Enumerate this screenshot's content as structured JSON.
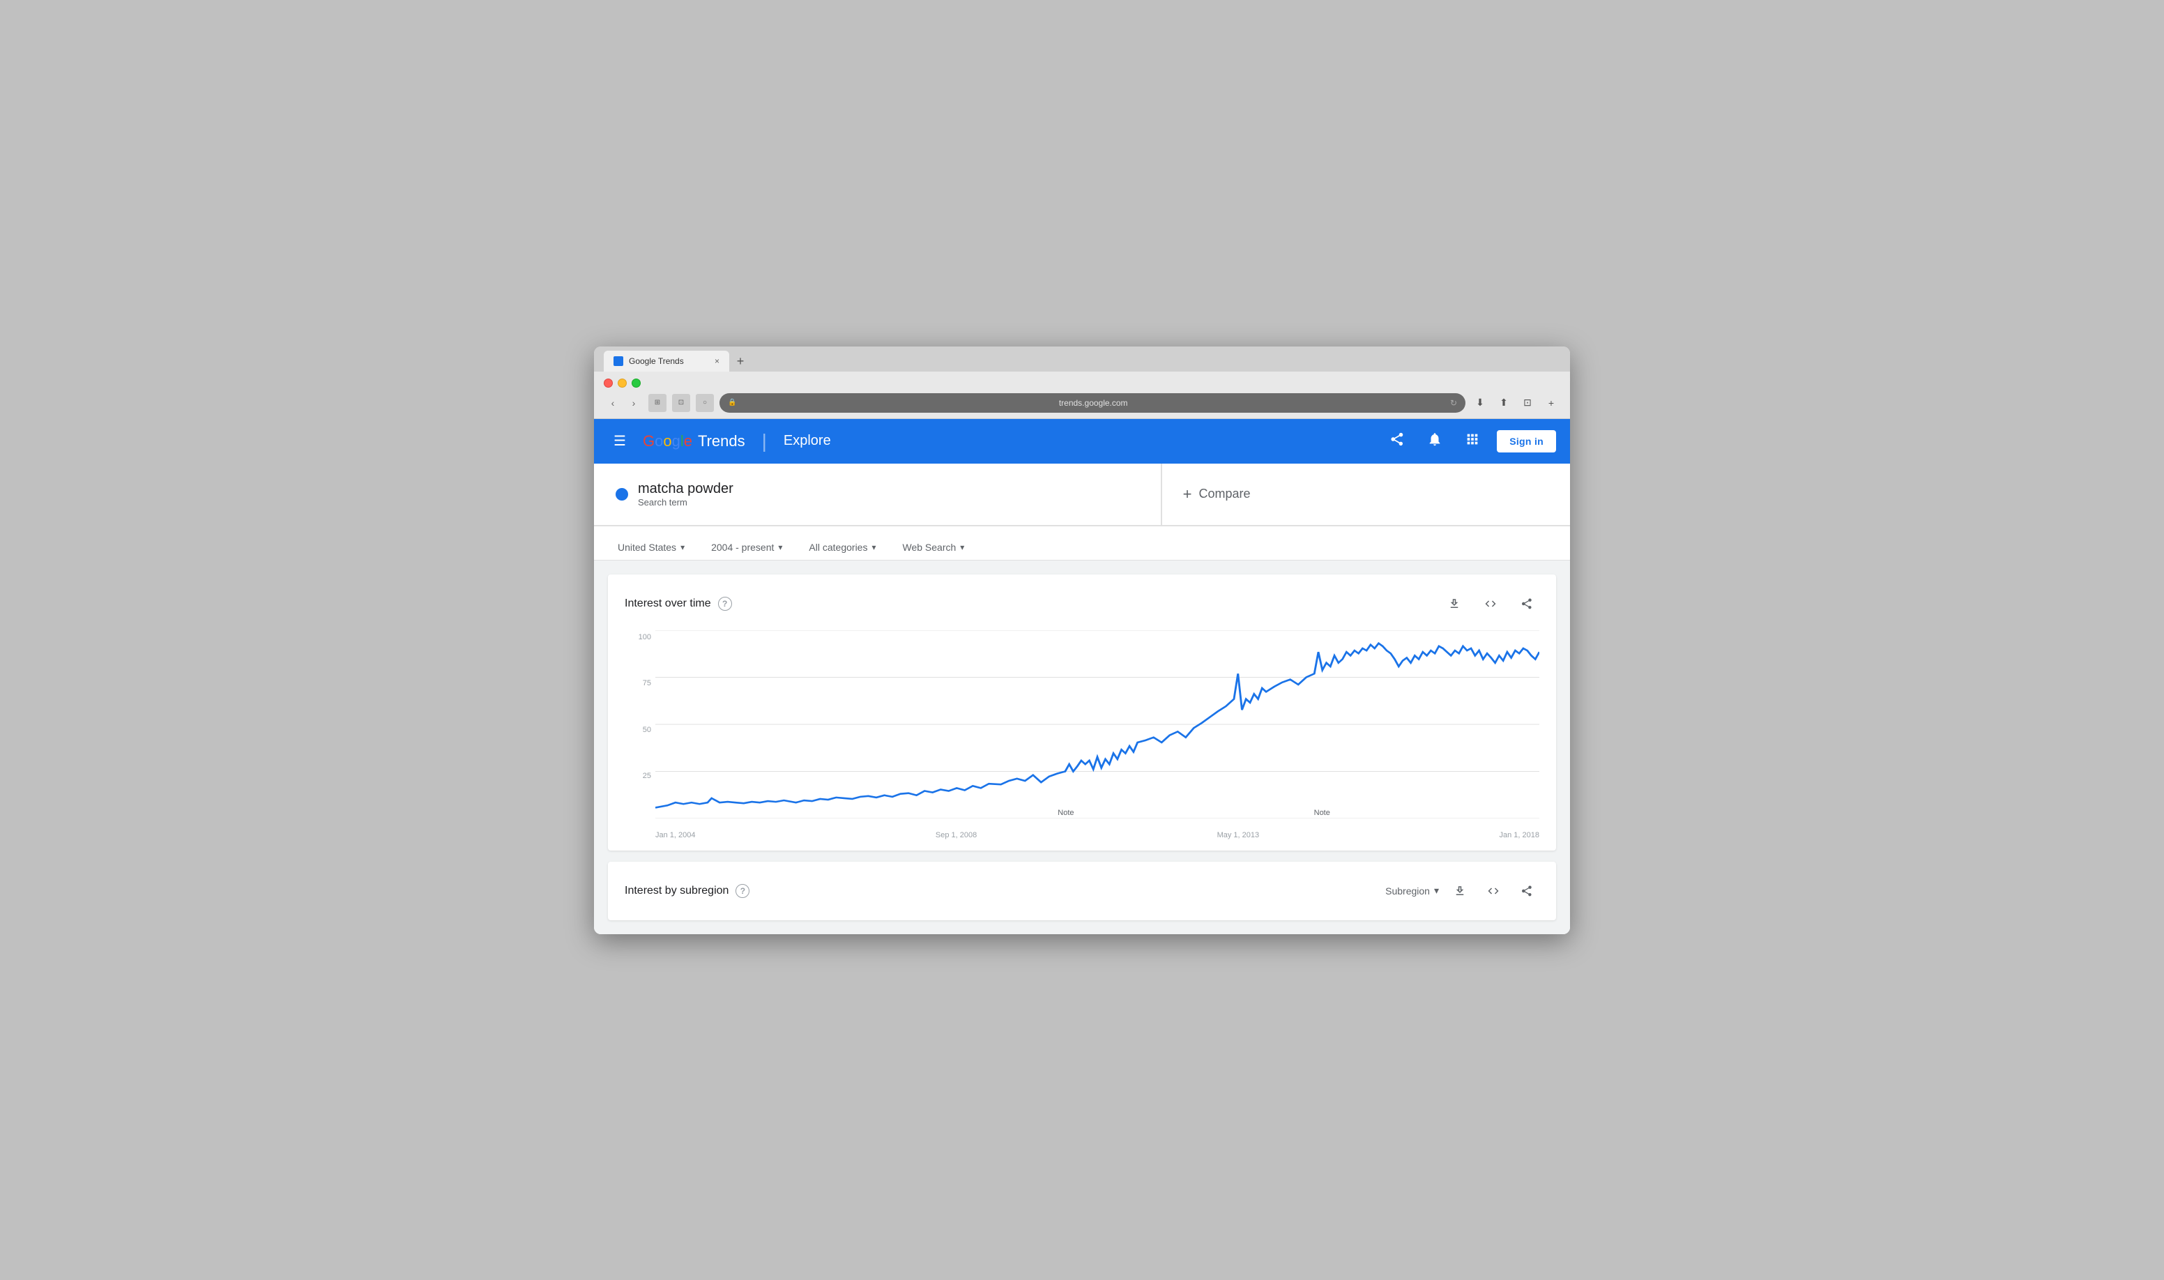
{
  "browser": {
    "url": "trends.google.com",
    "tab_title": "Google Trends",
    "back_label": "‹",
    "forward_label": "›",
    "lock_icon": "🔒",
    "refresh_icon": "↻"
  },
  "header": {
    "menu_label": "☰",
    "google_text": "Google",
    "trends_text": "Trends",
    "explore_text": "Explore",
    "share_icon": "share",
    "notification_icon": "notification",
    "apps_icon": "apps",
    "signin_label": "Sign in"
  },
  "search": {
    "term": "matcha powder",
    "term_type": "Search term",
    "dot_color": "#1a73e8",
    "compare_label": "Compare",
    "compare_plus": "+"
  },
  "filters": {
    "region": "United States",
    "period": "2004 - present",
    "category": "All categories",
    "search_type": "Web Search"
  },
  "chart": {
    "title": "Interest over time",
    "help_text": "?",
    "y_labels": [
      "100",
      "75",
      "50",
      "25",
      ""
    ],
    "x_labels": [
      "Jan 1, 2004",
      "Sep 1, 2008",
      "May 1, 2013",
      "Jan 1, 2018"
    ],
    "note1": "Note",
    "note2": "Note",
    "line_color": "#1a73e8",
    "download_icon": "⬇",
    "embed_icon": "<>",
    "share_icon": "share"
  },
  "subregion": {
    "title": "Interest by subregion",
    "help_text": "?",
    "dropdown_label": "Subregion",
    "download_icon": "⬇",
    "embed_icon": "<>",
    "share_icon": "share"
  }
}
